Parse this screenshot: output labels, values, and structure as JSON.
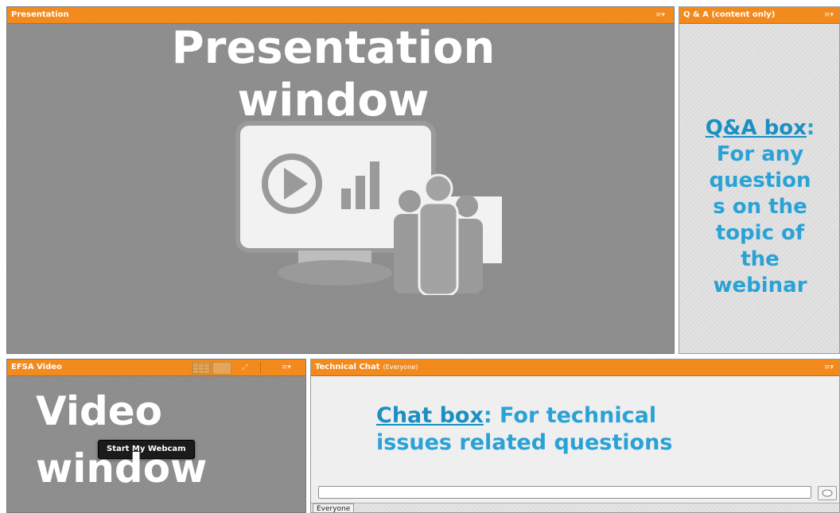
{
  "presentation": {
    "title": "Presentation",
    "overlay_line1": "Presentation",
    "overlay_line2": "window",
    "icon": "presentation-meeting-icon",
    "menu_icon": "menu-icon"
  },
  "qa": {
    "title": "Q & A (content only)",
    "note_link": "Q&A box",
    "note_colon": ":",
    "note_lines": [
      "For any",
      "question",
      "s on the",
      "topic of",
      "the",
      "webinar"
    ]
  },
  "video": {
    "title": "EFSA Video",
    "overlay_line1": "Video",
    "overlay_line2": "window",
    "webcam_button": "Start My Webcam",
    "icons": [
      "grid-layout-icon",
      "single-layout-icon",
      "fullscreen-icon",
      "menu-icon"
    ]
  },
  "chat": {
    "title": "Technical Chat",
    "audience": "(Everyone)",
    "note_link": "Chat box",
    "note_rest_line1": ": For technical",
    "note_line2": "issues related questions",
    "input_value": "",
    "send_icon": "speech-bubble-icon",
    "tab_label": "Everyone"
  },
  "colors": {
    "header": "#f28a1e",
    "accent_text": "#2aa2d6",
    "pod_dark": "#8c8c8c",
    "pod_light": "#e2e2e2"
  }
}
